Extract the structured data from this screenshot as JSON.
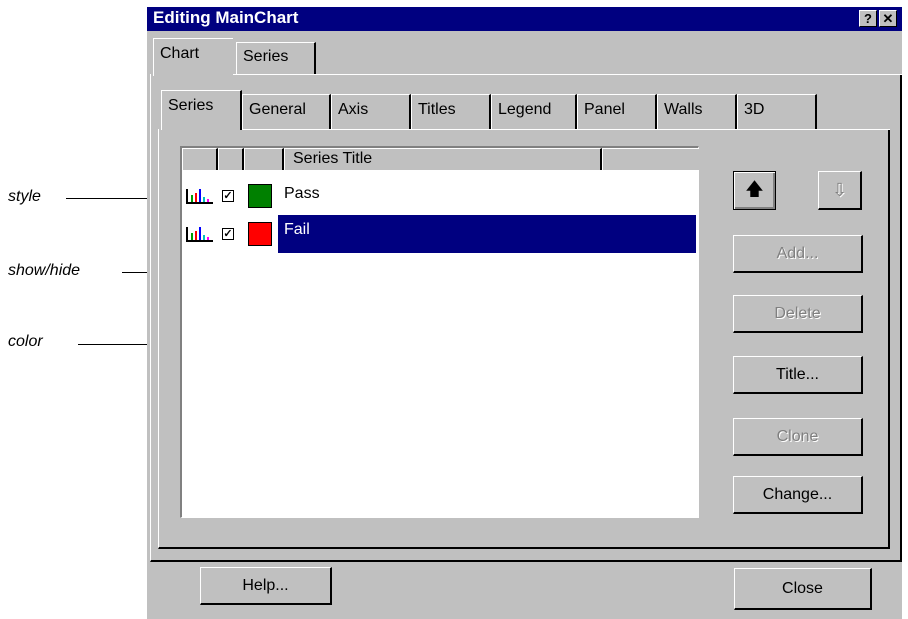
{
  "annotations": {
    "style": "style",
    "show_hide": "show/hide",
    "color": "color"
  },
  "window": {
    "title": "Editing MainChart",
    "help_glyph": "?",
    "close_glyph": "✕"
  },
  "outer_tabs": [
    "Chart",
    "Series"
  ],
  "inner_tabs": [
    "Series",
    "General",
    "Axis",
    "Titles",
    "Legend",
    "Panel",
    "Walls",
    "3D"
  ],
  "list": {
    "header": {
      "series_title": "Series Title"
    },
    "rows": [
      {
        "title": "Pass",
        "checked": true,
        "color": "#008000",
        "style_icon": "bar-chart-icon",
        "selected": false
      },
      {
        "title": "Fail",
        "checked": true,
        "color": "#ff0000",
        "style_icon": "bar-chart-icon",
        "selected": true
      }
    ]
  },
  "side_buttons": {
    "move_up_glyph": "🡅",
    "move_down_glyph": "⇩",
    "add": "Add...",
    "delete": "Delete",
    "title": "Title...",
    "clone": "Clone",
    "change": "Change..."
  },
  "footer": {
    "help": "Help...",
    "close": "Close"
  },
  "colors": {
    "titlebar": "#000080",
    "selection": "#000080",
    "face": "#c0c0c0"
  }
}
